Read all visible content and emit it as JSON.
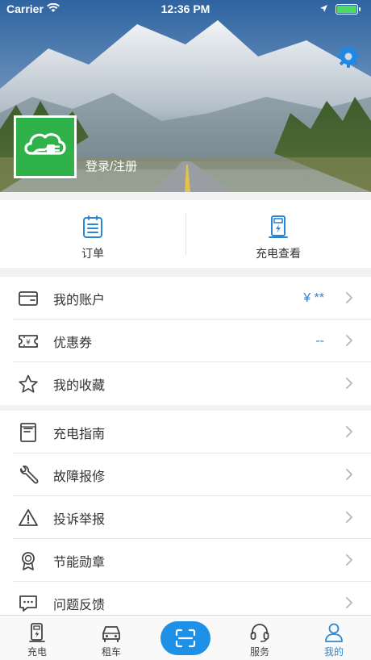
{
  "status_bar": {
    "carrier": "Carrier",
    "time": "12:36 PM"
  },
  "header": {
    "login_label": "登录/注册"
  },
  "quick_actions": [
    {
      "label": "订单",
      "icon": "order-list-icon"
    },
    {
      "label": "充电查看",
      "icon": "charging-pile-icon"
    }
  ],
  "account_group": [
    {
      "label": "我的账户",
      "value": "¥ **",
      "icon": "wallet-card-icon"
    },
    {
      "label": "优惠券",
      "value": "--",
      "icon": "coupon-ticket-icon"
    },
    {
      "label": "我的收藏",
      "value": "",
      "icon": "star-icon"
    }
  ],
  "service_group": [
    {
      "label": "充电指南",
      "icon": "guide-book-icon"
    },
    {
      "label": "故障报修",
      "icon": "wrench-icon"
    },
    {
      "label": "投诉举报",
      "icon": "warning-triangle-icon"
    },
    {
      "label": "节能勋章",
      "icon": "medal-icon"
    },
    {
      "label": "问题反馈",
      "icon": "feedback-chat-icon"
    }
  ],
  "tabbar": [
    {
      "label": "充电",
      "icon": "charger-icon",
      "active": false
    },
    {
      "label": "租车",
      "icon": "car-icon",
      "active": false
    },
    {
      "label": "",
      "icon": "scan-icon",
      "active": false
    },
    {
      "label": "服务",
      "icon": "headset-icon",
      "active": false
    },
    {
      "label": "我的",
      "icon": "person-icon",
      "active": true
    }
  ],
  "colors": {
    "accent": "#2a87d6",
    "brand_green": "#2fb24a",
    "scan_button": "#1e90e6"
  }
}
